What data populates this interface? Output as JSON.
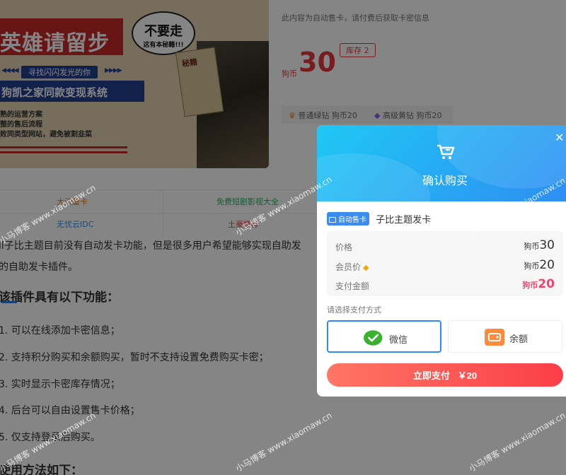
{
  "banner": {
    "slogan": "英雄请留步",
    "bubble_main": "不要走",
    "bubble_sub": "这有本秘籍!!!",
    "sub_slogan": "寻找闪闪发光的你",
    "arrows": "◀◀◀◀",
    "arrows_right": "▶▶▶▶",
    "system_title": "狗凯之家同款变现系统",
    "bullets": [
      "熟的运营方案",
      "整的售后流程",
      "败同类型网站，避免被割韭菜"
    ],
    "sign_text": "秘籍"
  },
  "product": {
    "auto_delivery_notice": "此内容为自动售卡，请付费后获取卡密信息",
    "price_unit": "狗币",
    "price": "30",
    "stock": "库存 2",
    "vip_tiers": [
      {
        "name": "普通绿钻 狗币20",
        "icon": "crown-icon"
      },
      {
        "name": "高级黄钻 狗币20",
        "icon": "diamond-icon"
      }
    ]
  },
  "link_grid": [
    {
      "text": "大流量卡",
      "color": "#e67e22"
    },
    {
      "text": "免费短剧影视大全",
      "color": "#27ae60"
    },
    {
      "text": "无忧云IDC",
      "color": "#2d8cf0"
    },
    {
      "text": "土豪推荐",
      "color": "#e4393c"
    }
  ],
  "article": {
    "intro_line1": "ll子比主题目前没有自动发卡功能，但是很多用户希望能够实现自助发",
    "intro_line2": "的自助发卡插件。",
    "heading1": "该插件具有以下功能：",
    "features": [
      "1. 可以在线添加卡密信息；",
      "2. 支持积分购买和余额购买，暂时不支持设置免费购买卡密；",
      "3. 实时显示卡密库存情况；",
      "4. 后台可以自由设置售卡价格；",
      "5. 仅支持登录后购买。"
    ],
    "heading2": "使用方法如下："
  },
  "modal": {
    "title": "确认购买",
    "badge": "自动售卡",
    "product_name": "子比主题发卡",
    "rows": [
      {
        "label": "价格",
        "unit": "狗币",
        "value": "30"
      },
      {
        "label": "会员价",
        "unit": "狗币",
        "value": "20"
      },
      {
        "label": "支付金额",
        "unit": "狗币",
        "value": "20"
      }
    ],
    "pay_label": "请选择支付方式",
    "pay_options": [
      {
        "name": "微信",
        "icon": "wechat-icon",
        "selected": true
      },
      {
        "name": "余额",
        "icon": "wallet-icon",
        "selected": false
      }
    ],
    "pay_button_label": "立即支付",
    "pay_button_amount": "￥20"
  },
  "watermark": {
    "text": "小马博客 www.xiaomaw.cn"
  },
  "colors": {
    "accent_blue": "#2d8cf0",
    "price_red": "#e4393c",
    "total_pink": "#f4426b",
    "button_gradient_start": "#ff7564",
    "button_gradient_end": "#fb3e49"
  }
}
